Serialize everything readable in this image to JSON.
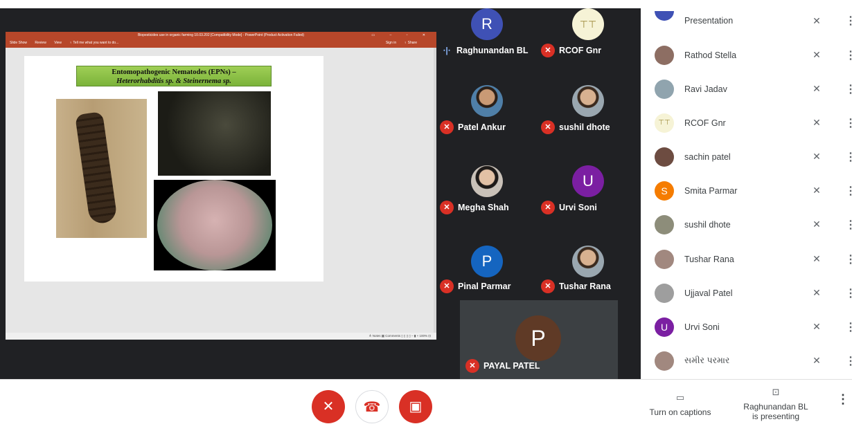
{
  "ppt": {
    "title": "Biopesticides use in organic farming 10.03.202 [Compatibility Mode] - PowerPoint (Product Activation Failed)",
    "menu": [
      "Slide Show",
      "Review",
      "View",
      "♀ Tell me what you want to do..."
    ],
    "sign_in": "Sign in",
    "share": "♀ Share",
    "status": "≙ Notes  ▦ Comments  ▯ ▯ ▯ ▯  –  ▮  +  100%  ⊡",
    "slide_title_line1": "Entomopathogenic Nematodes (EPNs) –",
    "slide_title_line2": "Heterorhabditis sp. & Steinernema sp."
  },
  "tiles": [
    {
      "name": "Raghunandan BL",
      "initial": "R",
      "color": "#3f51b5",
      "speaking": true
    },
    {
      "name": "RCOF Gnr",
      "initial": "",
      "color": "#f6f3d6",
      "speaking": false
    },
    {
      "name": "Patel Ankur",
      "initial": "",
      "color": "",
      "speaking": false
    },
    {
      "name": "sushil dhote",
      "initial": "",
      "color": "",
      "speaking": false
    },
    {
      "name": "Megha Shah",
      "initial": "",
      "color": "",
      "speaking": false
    },
    {
      "name": "Urvi Soni",
      "initial": "U",
      "color": "#7b1fa2",
      "speaking": false
    },
    {
      "name": "Pinal Parmar",
      "initial": "P",
      "color": "#1565c0",
      "speaking": false
    },
    {
      "name": "Tushar Rana",
      "initial": "",
      "color": "",
      "speaking": false
    }
  ],
  "presenter_tile": {
    "name": "PAYAL PATEL",
    "initial": "P"
  },
  "participants": {
    "partial_top_label": "Presentation",
    "list": [
      {
        "name": "Rathod Stella",
        "initial": "",
        "color": "#8d6e63"
      },
      {
        "name": "Ravi Jadav",
        "initial": "",
        "color": "#90a4ae"
      },
      {
        "name": "RCOF Gnr",
        "initial": "",
        "color": "#f6f3d6"
      },
      {
        "name": "sachin patel",
        "initial": "",
        "color": "#6d4c41"
      },
      {
        "name": "Smita Parmar",
        "initial": "S",
        "color": "#f57c00"
      },
      {
        "name": "sushil dhote",
        "initial": "",
        "color": "#8d8d7a"
      },
      {
        "name": "Tushar Rana",
        "initial": "",
        "color": "#a1887f"
      },
      {
        "name": "Ujjaval Patel",
        "initial": "",
        "color": "#9e9e9e"
      },
      {
        "name": "Urvi Soni",
        "initial": "U",
        "color": "#7b1fa2"
      },
      {
        "name": "સમીર પરમાર",
        "initial": "",
        "color": "#a1887f"
      }
    ]
  },
  "controls": {
    "mic_icon": "mic-off-icon",
    "hangup_icon": "hang-up-icon",
    "camera_icon": "camera-off-icon",
    "captions_label": "Turn on captions",
    "presenting_line1": "Raghunandan BL",
    "presenting_line2": "is presenting"
  }
}
